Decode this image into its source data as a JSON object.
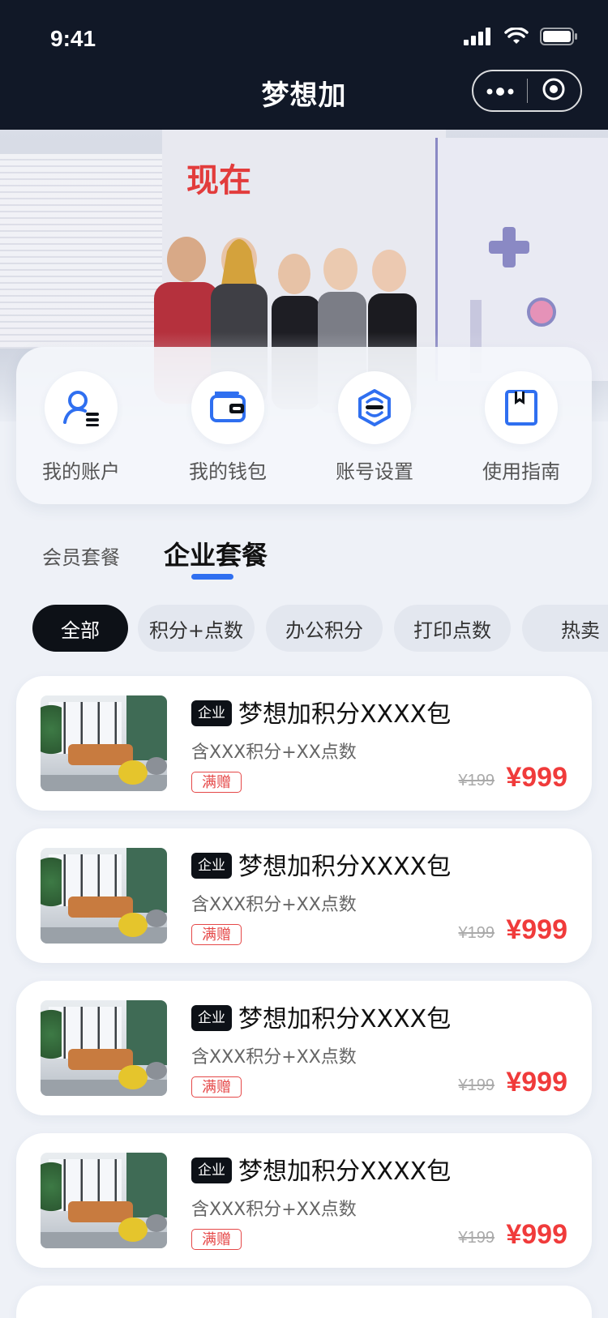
{
  "status_bar": {
    "time": "9:41"
  },
  "nav": {
    "title": "梦想加"
  },
  "banner": {
    "headline": "现在"
  },
  "quick_actions": [
    {
      "label": "我的账户",
      "icon": "user-account-icon"
    },
    {
      "label": "我的钱包",
      "icon": "wallet-icon"
    },
    {
      "label": "账号设置",
      "icon": "settings-icon"
    },
    {
      "label": "使用指南",
      "icon": "guide-book-icon"
    }
  ],
  "tabs": [
    {
      "label": "会员套餐",
      "active": false
    },
    {
      "label": "企业套餐",
      "active": true
    }
  ],
  "chips": [
    {
      "label": "全部",
      "active": true
    },
    {
      "label": "积分+点数",
      "active": false
    },
    {
      "label": "办公积分",
      "active": false
    },
    {
      "label": "打印点数",
      "active": false
    },
    {
      "label": "热卖",
      "active": false
    }
  ],
  "products": [
    {
      "tag": "企业",
      "title": "梦想加积分XXXX包",
      "subtitle": "含XXX积分+XX点数",
      "gift": "满赠",
      "old_price": "¥199",
      "price": "¥999"
    },
    {
      "tag": "企业",
      "title": "梦想加积分XXXX包",
      "subtitle": "含XXX积分+XX点数",
      "gift": "满赠",
      "old_price": "¥199",
      "price": "¥999"
    },
    {
      "tag": "企业",
      "title": "梦想加积分XXXX包",
      "subtitle": "含XXX积分+XX点数",
      "gift": "满赠",
      "old_price": "¥199",
      "price": "¥999"
    },
    {
      "tag": "企业",
      "title": "梦想加积分XXXX包",
      "subtitle": "含XXX积分+XX点数",
      "gift": "满赠",
      "old_price": "¥199",
      "price": "¥999"
    }
  ],
  "colors": {
    "topbar_bg": "#111827",
    "accent_blue": "#2f6ff0",
    "price_red": "#f03b3b",
    "chip_active_bg": "#0d1117"
  }
}
